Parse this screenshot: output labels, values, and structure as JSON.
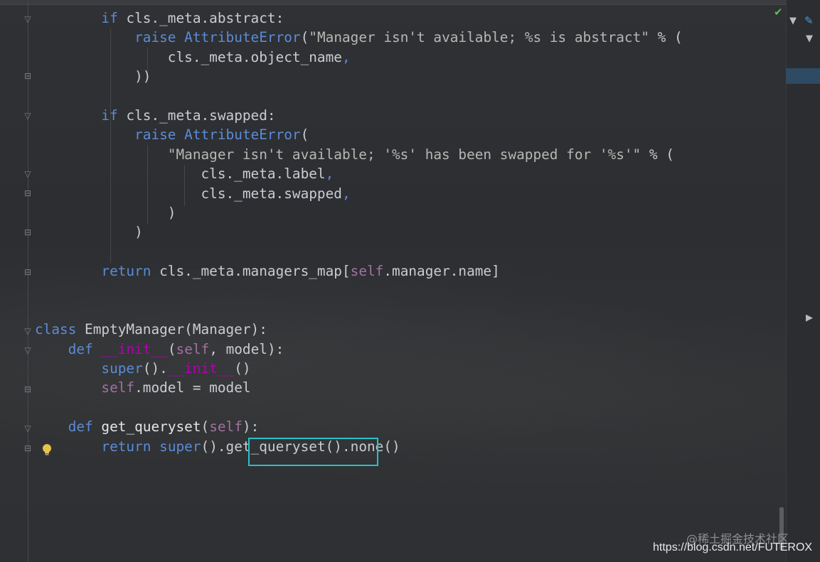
{
  "editor": {
    "lines": [
      {
        "indent": "        ",
        "tokens": [
          {
            "t": "if",
            "c": "kw"
          },
          {
            "t": " cls._meta.abstract:",
            "c": "cls"
          }
        ]
      },
      {
        "indent": "            ",
        "tokens": [
          {
            "t": "raise",
            "c": "kw"
          },
          {
            "t": " ",
            "c": "cls"
          },
          {
            "t": "AttributeError",
            "c": "kw"
          },
          {
            "t": "(",
            "c": "cls"
          },
          {
            "t": "\"Manager isn't available; %s is abstract\"",
            "c": "str"
          },
          {
            "t": " % (",
            "c": "cls"
          }
        ]
      },
      {
        "indent": "                ",
        "tokens": [
          {
            "t": "cls._meta.object_name",
            "c": "cls"
          },
          {
            "t": ",",
            "c": "kw"
          }
        ]
      },
      {
        "indent": "            ",
        "tokens": [
          {
            "t": "))",
            "c": "cls"
          }
        ]
      },
      {
        "indent": "",
        "tokens": []
      },
      {
        "indent": "        ",
        "tokens": [
          {
            "t": "if",
            "c": "kw"
          },
          {
            "t": " cls._meta.swapped:",
            "c": "cls"
          }
        ]
      },
      {
        "indent": "            ",
        "tokens": [
          {
            "t": "raise",
            "c": "kw"
          },
          {
            "t": " ",
            "c": "cls"
          },
          {
            "t": "AttributeError",
            "c": "kw"
          },
          {
            "t": "(",
            "c": "cls"
          }
        ]
      },
      {
        "indent": "                ",
        "tokens": [
          {
            "t": "\"Manager isn't available; '%s' has been swapped for '%s'\"",
            "c": "str"
          },
          {
            "t": " % (",
            "c": "cls"
          }
        ]
      },
      {
        "indent": "                    ",
        "tokens": [
          {
            "t": "cls._meta.label",
            "c": "cls"
          },
          {
            "t": ",",
            "c": "kw"
          }
        ]
      },
      {
        "indent": "                    ",
        "tokens": [
          {
            "t": "cls._meta.swapped",
            "c": "cls"
          },
          {
            "t": ",",
            "c": "kw"
          }
        ]
      },
      {
        "indent": "                ",
        "tokens": [
          {
            "t": ")",
            "c": "cls"
          }
        ]
      },
      {
        "indent": "            ",
        "tokens": [
          {
            "t": ")",
            "c": "cls"
          }
        ]
      },
      {
        "indent": "",
        "tokens": []
      },
      {
        "indent": "        ",
        "tokens": [
          {
            "t": "return",
            "c": "kw"
          },
          {
            "t": " cls._meta.managers_map[",
            "c": "cls"
          },
          {
            "t": "self",
            "c": "slf"
          },
          {
            "t": ".manager.name]",
            "c": "cls"
          }
        ]
      },
      {
        "indent": "",
        "tokens": []
      },
      {
        "indent": "",
        "tokens": []
      },
      {
        "indent": "",
        "tokens": [
          {
            "t": "class",
            "c": "kw"
          },
          {
            "t": " EmptyManager(Manager):",
            "c": "cls"
          }
        ]
      },
      {
        "indent": "    ",
        "tokens": [
          {
            "t": "def",
            "c": "kw"
          },
          {
            "t": " ",
            "c": "cls"
          },
          {
            "t": "__init__",
            "c": "mg"
          },
          {
            "t": "(",
            "c": "cls"
          },
          {
            "t": "self",
            "c": "slf"
          },
          {
            "t": ", model):",
            "c": "cls"
          }
        ]
      },
      {
        "indent": "        ",
        "tokens": [
          {
            "t": "super",
            "c": "kw"
          },
          {
            "t": "().",
            "c": "cls"
          },
          {
            "t": "__init__",
            "c": "mg"
          },
          {
            "t": "()",
            "c": "cls"
          }
        ]
      },
      {
        "indent": "        ",
        "tokens": [
          {
            "t": "self",
            "c": "slf"
          },
          {
            "t": ".model = model",
            "c": "cls"
          }
        ]
      },
      {
        "indent": "",
        "tokens": []
      },
      {
        "indent": "    ",
        "tokens": [
          {
            "t": "def",
            "c": "kw"
          },
          {
            "t": " ",
            "c": "cls"
          },
          {
            "t": "get_queryset",
            "c": "fn"
          },
          {
            "t": "(",
            "c": "cls"
          },
          {
            "t": "self",
            "c": "slf"
          },
          {
            "t": "):",
            "c": "cls"
          }
        ]
      },
      {
        "indent": "        ",
        "tokens": [
          {
            "t": "return",
            "c": "kw"
          },
          {
            "t": " ",
            "c": "cls"
          },
          {
            "t": "super",
            "c": "kw"
          },
          {
            "t": "().get_queryset().none()",
            "c": "cls"
          }
        ]
      }
    ]
  },
  "gutter": {
    "fold_icons": [
      "fold-icon"
    ],
    "bulb_icon": "lightbulb-icon"
  },
  "colors": {
    "background": "#2c2e32",
    "keyword": "#5c8bd6",
    "self": "#a470a0",
    "magic": "#b200b2",
    "highlight_box": "#29c0c9",
    "check": "#5fb95f"
  },
  "status": {
    "inspection_ok_icon": "checkmark-icon"
  },
  "watermark": {
    "cn": "@稀土掘金技术社区",
    "url": "https://blog.csdn.net/FUTEROX"
  }
}
